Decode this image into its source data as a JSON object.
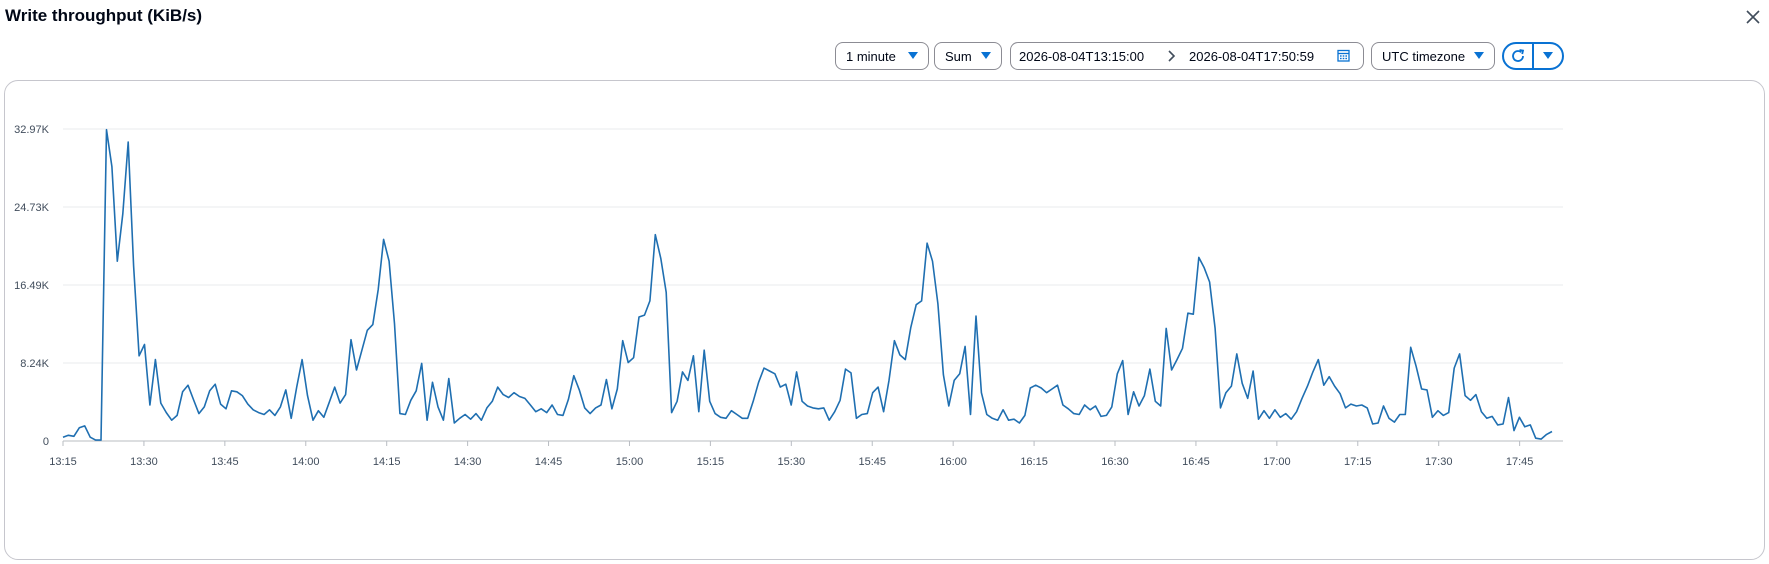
{
  "header": {
    "title": "Write throughput (KiB/s)"
  },
  "icons": {
    "close": "close-icon",
    "caret": "caret-down-icon",
    "calendar": "calendar-icon",
    "refresh": "refresh-icon",
    "chevron": "chevron-right-icon"
  },
  "toolbar": {
    "period_label": "1 minute",
    "statistic_label": "Sum",
    "range_start": "2026-08-04T13:15:00",
    "range_end": "2026-08-04T17:50:59",
    "timezone_label": "UTC timezone"
  },
  "colors": {
    "line": "#1f6fb1",
    "accent": "#0972d3",
    "grid": "#e9ebed"
  },
  "chart_data": {
    "type": "line",
    "title": "Write throughput (KiB/s)",
    "xlabel": "",
    "ylabel": "",
    "ylim": [
      0,
      32970
    ],
    "y_ticks": [
      "0",
      "8.24K",
      "16.49K",
      "24.73K",
      "32.97K"
    ],
    "y_tick_values": [
      0,
      8243,
      16485,
      24728,
      32970
    ],
    "x_range": [
      "13:15",
      "17:51"
    ],
    "x_ticks": [
      "13:15",
      "13:30",
      "13:45",
      "14:00",
      "14:15",
      "14:30",
      "14:45",
      "15:00",
      "15:15",
      "15:30",
      "15:45",
      "16:00",
      "16:15",
      "16:30",
      "16:45",
      "17:00",
      "17:15",
      "17:30",
      "17:45"
    ],
    "grid": true,
    "legend": "none",
    "series": [
      {
        "values": [
          400,
          600,
          500,
          1400,
          1600,
          400,
          100,
          100,
          32900,
          29000,
          19000,
          24000,
          31600,
          18500,
          9000,
          10200,
          3800,
          8600,
          4000,
          3000,
          2200,
          2700,
          5200,
          5900,
          4400,
          2900,
          3600,
          5300,
          6000,
          3900,
          3400,
          5300,
          5200,
          4800,
          3900,
          3300,
          3000,
          2800,
          3300,
          2700,
          3600,
          5400,
          2400,
          5700,
          8600,
          4800,
          2200,
          3200,
          2500,
          4100,
          5700,
          4000,
          4900,
          10700,
          7500,
          9600,
          11700,
          12300,
          16000,
          21300,
          19000,
          12400,
          2900,
          2800,
          4300,
          5300,
          8200,
          2200,
          6200,
          3600,
          2200,
          6600,
          1900,
          2400,
          2800,
          2300,
          2900,
          2200,
          3500,
          4200,
          5700,
          4900,
          4600,
          5100,
          4700,
          4500,
          3800,
          3100,
          3400,
          3000,
          3800,
          2800,
          2700,
          4400,
          6900,
          5400,
          3500,
          2900,
          3500,
          3800,
          6500,
          3400,
          5500,
          10600,
          8300,
          8800,
          13100,
          13300,
          14800,
          21800,
          19300,
          15700,
          3000,
          4200,
          7300,
          6400,
          9000,
          3100,
          9600,
          4200,
          2900,
          2500,
          2400,
          3200,
          2800,
          2400,
          2400,
          4200,
          6200,
          7700,
          7400,
          7100,
          5700,
          6000,
          3800,
          7300,
          4200,
          3700,
          3500,
          3400,
          3500,
          2200,
          3100,
          4300,
          7600,
          7200,
          2400,
          2800,
          2900,
          5100,
          5700,
          3100,
          6400,
          10600,
          9100,
          8600,
          12000,
          14400,
          14800,
          20900,
          19000,
          14500,
          7000,
          3700,
          6400,
          7100,
          10000,
          2800,
          13200,
          5100,
          2800,
          2400,
          2200,
          3300,
          2200,
          2300,
          1900,
          2700,
          5600,
          5900,
          5600,
          5100,
          5500,
          5900,
          3800,
          3400,
          2900,
          2800,
          3800,
          3300,
          3700,
          2600,
          2700,
          3600,
          7100,
          8500,
          2800,
          5200,
          3700,
          4800,
          7600,
          4200,
          3700,
          11900,
          7500,
          8600,
          9800,
          13500,
          13400,
          19400,
          18300,
          16800,
          11900,
          3500,
          5100,
          5800,
          9200,
          6100,
          4500,
          7400,
          2300,
          3200,
          2400,
          3300,
          2500,
          2900,
          2300,
          3100,
          4500,
          5800,
          7300,
          8600,
          5900,
          6800,
          5800,
          5000,
          3500,
          3900,
          3700,
          3800,
          3500,
          1800,
          1900,
          3700,
          2400,
          2000,
          2800,
          2800,
          9900,
          7900,
          5500,
          5400,
          2500,
          3200,
          2700,
          3000,
          7700,
          9200,
          4800,
          4300,
          4900,
          3100,
          2400,
          2600,
          1700,
          1800,
          4600,
          1100,
          2500,
          1500,
          1700,
          300,
          200,
          700,
          1000
        ]
      }
    ]
  }
}
